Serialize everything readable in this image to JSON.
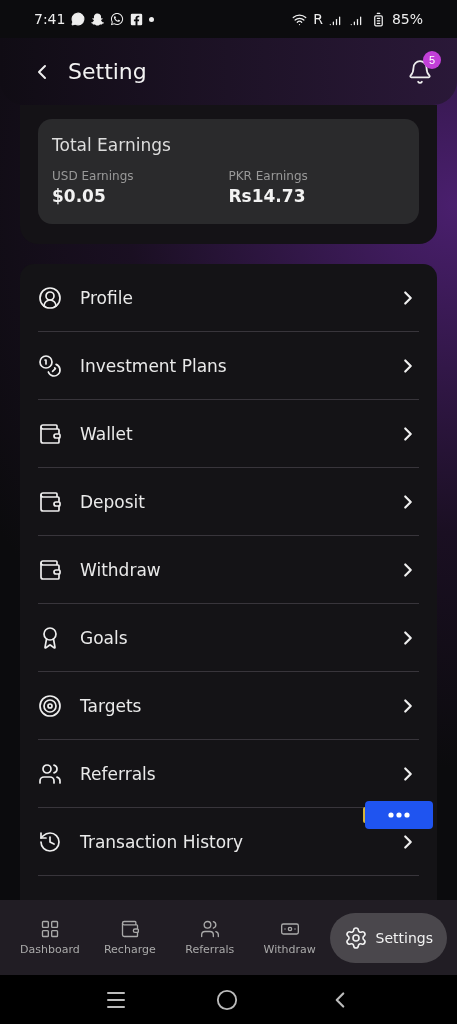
{
  "status_bar": {
    "time": "7:41",
    "roaming": "R",
    "battery": "85%"
  },
  "header": {
    "title": "Setting",
    "notification_count": "5"
  },
  "earnings": {
    "title": "Total Earnings",
    "items": [
      {
        "label": "USD Earnings",
        "value": "$0.05"
      },
      {
        "label": "PKR Earnings",
        "value": "Rs14.73"
      }
    ]
  },
  "menu": [
    {
      "label": "Profile"
    },
    {
      "label": "Investment Plans"
    },
    {
      "label": "Wallet"
    },
    {
      "label": "Deposit"
    },
    {
      "label": "Withdraw"
    },
    {
      "label": "Goals"
    },
    {
      "label": "Targets"
    },
    {
      "label": "Referrals"
    },
    {
      "label": "Transaction History"
    }
  ],
  "bottom_nav": [
    {
      "label": "Dashboard",
      "selected": false
    },
    {
      "label": "Recharge",
      "selected": false
    },
    {
      "label": "Referrals",
      "selected": false
    },
    {
      "label": "Withdraw",
      "selected": false
    },
    {
      "label": "Settings",
      "selected": true
    }
  ]
}
